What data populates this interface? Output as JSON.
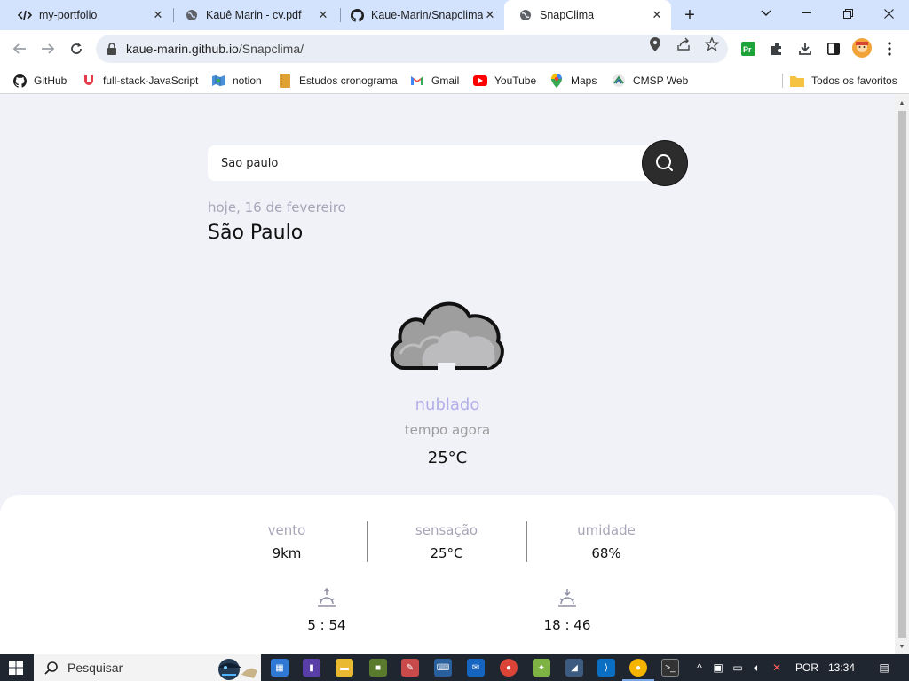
{
  "browser": {
    "tabs": [
      {
        "title": "my-portfolio",
        "icon": "code-icon",
        "active": false
      },
      {
        "title": "Kauê Marin - cv.pdf",
        "icon": "globe-icon",
        "active": false
      },
      {
        "title": "Kaue-Marin/Snapclima",
        "icon": "github-icon",
        "active": false
      },
      {
        "title": "SnapClima",
        "icon": "globe-icon",
        "active": true
      }
    ],
    "url_host": "kaue-marin.github.io",
    "url_path": "/Snapclima/",
    "bookmarks": [
      {
        "label": "GitHub",
        "icon": "github-icon"
      },
      {
        "label": "full-stack-JavaScript",
        "icon": "magnet-icon"
      },
      {
        "label": "notion",
        "icon": "map-icon"
      },
      {
        "label": "Estudos cronograma",
        "icon": "notebook-icon"
      },
      {
        "label": "Gmail",
        "icon": "gmail-icon"
      },
      {
        "label": "YouTube",
        "icon": "youtube-icon"
      },
      {
        "label": "Maps",
        "icon": "maps-pin-icon"
      },
      {
        "label": "CMSP Web",
        "icon": "cmsp-icon"
      }
    ],
    "all_bookmarks": "Todos os favoritos"
  },
  "app": {
    "search_value": "Sao paulo",
    "date": "hoje, 16 de fevereiro",
    "city": "São Paulo",
    "description": "nublado",
    "subtitle": "tempo agora",
    "temperature": "25°C",
    "stats": [
      {
        "label": "vento",
        "value": "9km"
      },
      {
        "label": "sensação",
        "value": "25°C"
      },
      {
        "label": "umidade",
        "value": "68%"
      }
    ],
    "sunrise": "5 : 54",
    "sunset": "18 : 46",
    "colors": {
      "accent": "#b3aee8",
      "muted": "#a6a6b8",
      "background": "#f1f1f8",
      "search_button": "#2c2c2c"
    }
  },
  "taskbar": {
    "search_placeholder": "Pesquisar",
    "language": "POR",
    "time": "13:34"
  }
}
